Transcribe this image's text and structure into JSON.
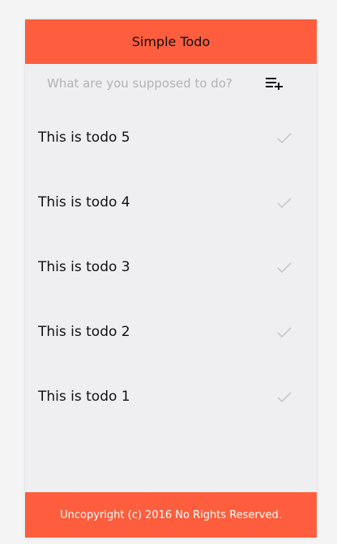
{
  "header": {
    "title": "Simple Todo"
  },
  "input": {
    "placeholder": "What are you supposed to do?",
    "value": ""
  },
  "add_button": {
    "icon": "playlist-add-icon"
  },
  "todos": [
    {
      "text": "This is todo 5",
      "done_icon": "check-icon"
    },
    {
      "text": "This is todo 4",
      "done_icon": "check-icon"
    },
    {
      "text": "This is todo 3",
      "done_icon": "check-icon"
    },
    {
      "text": "This is todo 2",
      "done_icon": "check-icon"
    },
    {
      "text": "This is todo 1",
      "done_icon": "check-icon"
    }
  ],
  "footer": {
    "text": "Uncopyright (c) 2016 No Rights Reserved."
  },
  "colors": {
    "accent": "#fe5e3d",
    "background": "#efeff1",
    "check": "#c8c8ca"
  }
}
